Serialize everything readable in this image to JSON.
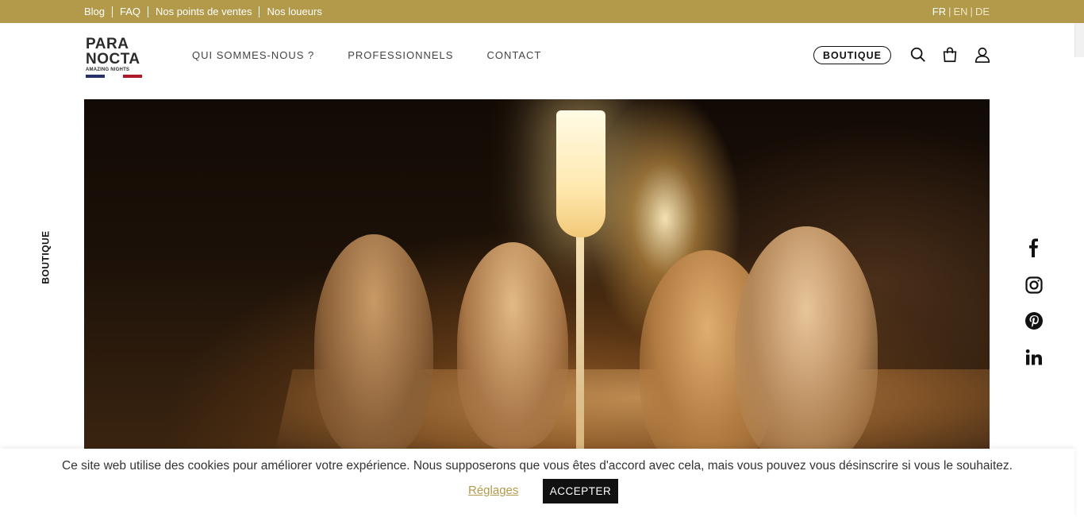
{
  "topbar": {
    "links": [
      "Blog",
      "FAQ",
      "Nos points de ventes",
      "Nos loueurs"
    ],
    "languages": [
      {
        "code": "FR",
        "active": true
      },
      {
        "code": "EN",
        "active": false
      },
      {
        "code": "DE",
        "active": false
      }
    ],
    "bg_color": "#b29a4a"
  },
  "logo": {
    "line1": "PARA",
    "line2": "NOCTA",
    "tagline": "AMAZING NIGHTS"
  },
  "nav": {
    "items": [
      "QUI SOMMES-NOUS ?",
      "PROFESSIONNELS",
      "CONTACT"
    ]
  },
  "header": {
    "boutique_label": "BOUTIQUE",
    "icons": [
      "search-icon",
      "shopping-bag-icon",
      "user-icon"
    ]
  },
  "side": {
    "boutique_label": "BOUTIQUE"
  },
  "social": [
    "facebook-icon",
    "instagram-icon",
    "pinterest-icon",
    "linkedin-icon"
  ],
  "cookie": {
    "message": "Ce site web utilise des cookies pour améliorer votre expérience. Nous supposerons que vous êtes d'accord avec cela, mais vous pouvez vous désinscrire si vous le souhaitez.",
    "settings_label": "Réglages",
    "accept_label": "ACCEPTER",
    "accent_color": "#b29a4a"
  }
}
